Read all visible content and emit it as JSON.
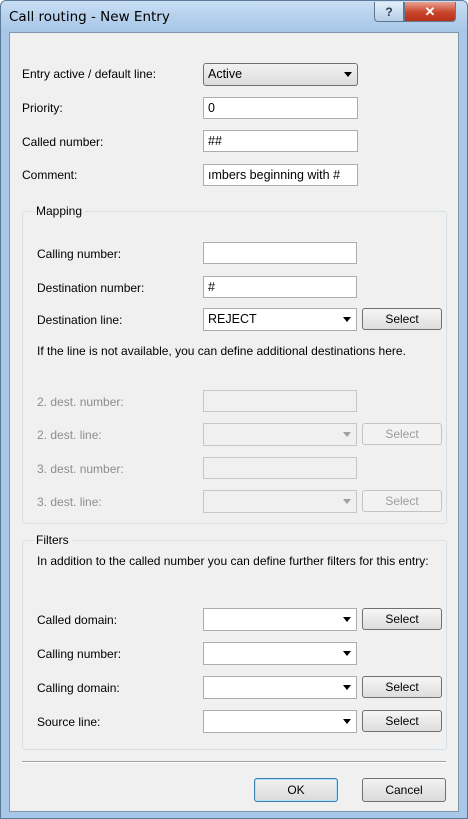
{
  "window": {
    "title": "Call routing - New Entry",
    "help_glyph": "?",
    "close_glyph": "✕"
  },
  "general": {
    "entry_active_label": "Entry active / default line:",
    "entry_active_value": "Active",
    "priority_label": "Priority:",
    "priority_value": "0",
    "called_number_label": "Called number:",
    "called_number_value": "##",
    "comment_label": "Comment:",
    "comment_value": "ımbers beginning with #"
  },
  "mapping": {
    "group_label": "Mapping",
    "calling_number_label": "Calling number:",
    "calling_number_value": "",
    "destination_number_label": "Destination number:",
    "destination_number_value": "#",
    "destination_line_label": "Destination line:",
    "destination_line_value": "REJECT",
    "select_label": "Select",
    "info_text": "If the line is not available, you can define additional destinations here.",
    "dest2_number_label": "2. dest. number:",
    "dest2_line_label": "2. dest. line:",
    "dest3_number_label": "3. dest. number:",
    "dest3_line_label": "3. dest. line:"
  },
  "filters": {
    "group_label": "Filters",
    "info_text": "In addition to the called number you can define further filters for this entry:",
    "called_domain_label": "Called domain:",
    "calling_number_label": "Calling number:",
    "calling_domain_label": "Calling domain:",
    "source_line_label": "Source line:",
    "select_label": "Select"
  },
  "buttons": {
    "ok": "OK",
    "cancel": "Cancel"
  }
}
